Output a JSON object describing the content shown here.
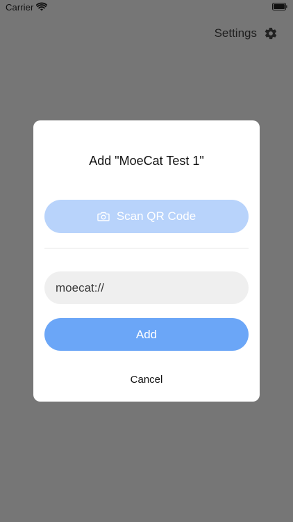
{
  "status_bar": {
    "carrier": "Carrier",
    "wifi_icon": "wifi-icon",
    "battery_icon": "battery-icon"
  },
  "header": {
    "settings_label": "Settings",
    "settings_icon": "gear-icon"
  },
  "modal": {
    "title": "Add \"MoeCat Test 1\"",
    "scan_button": {
      "label": "Scan QR Code",
      "icon": "camera-icon"
    },
    "url_field": {
      "value": "moecat://"
    },
    "add_button_label": "Add",
    "cancel_button_label": "Cancel"
  },
  "colors": {
    "backdrop": "#767676",
    "modal_bg": "#ffffff",
    "scan_button_bg": "#b8d3fb",
    "add_button_bg": "#6ba6f7",
    "field_bg": "#efefef",
    "divider": "#e6e6e6"
  }
}
